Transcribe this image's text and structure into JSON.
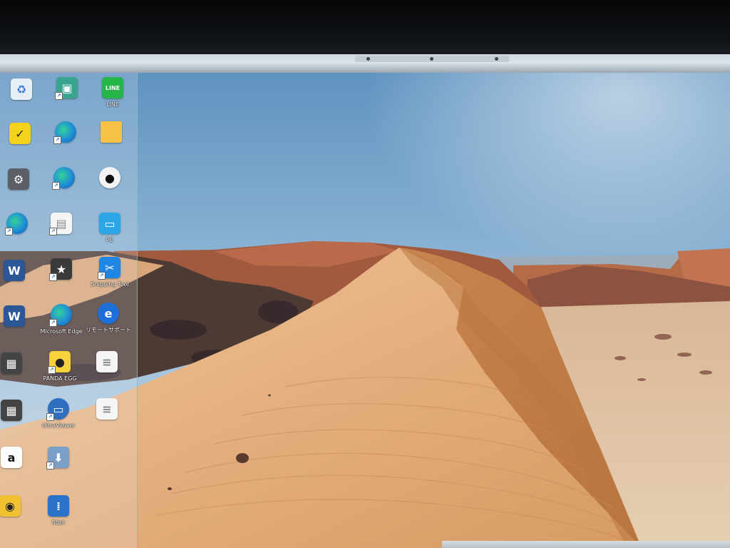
{
  "desktop": {
    "icons": [
      {
        "icon": "recycle-bin-icon",
        "label": ""
      },
      {
        "icon": "app-shortcut-icon",
        "label": ""
      },
      {
        "icon": "line-app-icon",
        "label": "LINE"
      },
      {
        "icon": "todo-app-icon",
        "label": ""
      },
      {
        "icon": "edge-shortcut-icon",
        "label": ""
      },
      {
        "icon": "folder-icon",
        "label": ""
      },
      {
        "icon": "settings-shortcut-icon",
        "label": ""
      },
      {
        "icon": "edge-shortcut-icon",
        "label": ""
      },
      {
        "icon": "panda-game-icon",
        "label": ""
      },
      {
        "icon": "edge-shortcut-icon",
        "label": ""
      },
      {
        "icon": "canon-shortcut-icon",
        "label": ""
      },
      {
        "icon": "pc-icon",
        "label": "PC"
      },
      {
        "icon": "word-document-icon",
        "label": ""
      },
      {
        "icon": "canon-app-icon",
        "label": ""
      },
      {
        "icon": "snipping-tool-icon",
        "label": "Snipping Tool"
      },
      {
        "icon": "word-document-icon",
        "label": ""
      },
      {
        "icon": "microsoft-edge-icon",
        "label": "Microsoft Edge"
      },
      {
        "icon": "internet-explorer-icon",
        "label": "リモートサポート"
      },
      {
        "icon": "video-file-icon",
        "label": ""
      },
      {
        "icon": "panda-egg-icon",
        "label": "PANDA EGG"
      },
      {
        "icon": "text-file-icon",
        "label": ""
      },
      {
        "icon": "video-file-icon",
        "label": ""
      },
      {
        "icon": "ultraviewer-icon",
        "label": "UltraViewer"
      },
      {
        "icon": "text-file-icon",
        "label": ""
      },
      {
        "icon": "amazon-icon",
        "label": ""
      },
      {
        "icon": "setup-icon",
        "label": ""
      },
      {
        "icon": "game-icon",
        "label": ""
      },
      {
        "icon": "fitbit-icon",
        "label": "fitbit"
      }
    ]
  },
  "colors": {
    "sky_top": "#6e9ec6",
    "sky_bottom": "#bcd2e2",
    "dune_light": "#e3b07f",
    "dune_shadow": "#c98752",
    "rock_dark": "#5a3d33",
    "rock_red": "#a0573d"
  }
}
